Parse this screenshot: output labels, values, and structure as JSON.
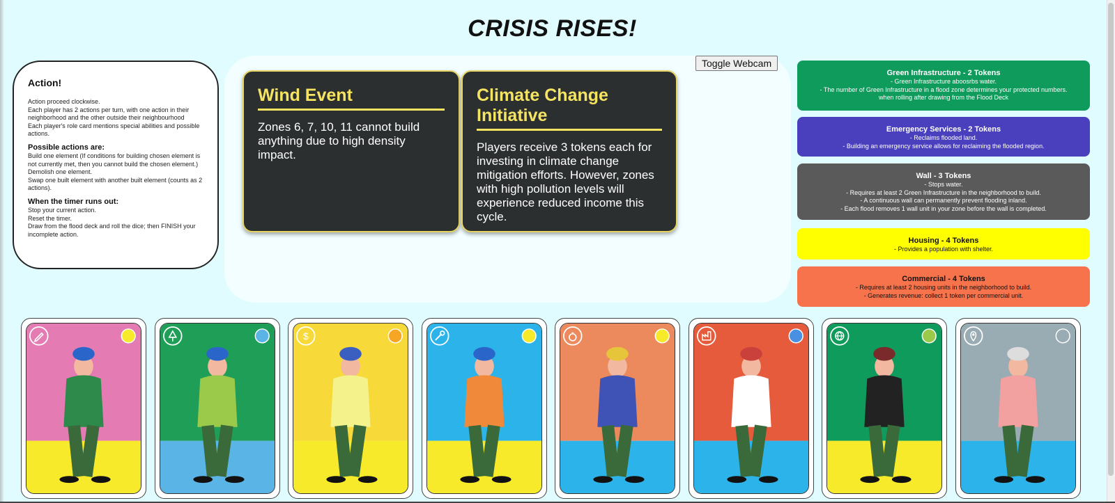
{
  "page": {
    "title": "CRISIS RISES!"
  },
  "action_panel": {
    "heading": "Action!",
    "intro": [
      "Action proceed clockwise.",
      "Each player has 2 actions per turn, with one action in their neighborhood and the other outside their neighbourhood",
      "Each player's role card mentions special abilities and possible actions."
    ],
    "possible_heading": "Possible actions are:",
    "possible": [
      "Build one element (If conditions for building chosen element is not currently met, then you cannot build the chosen element.)",
      "Demolish one element.",
      "Swap one built element with another built element (counts as 2 actions)."
    ],
    "timer_heading": "When the timer runs out:",
    "timer": [
      "Stop your current action.",
      "Reset the timer.",
      "Draw from the flood deck and roll the dice; then FINISH your incomplete action."
    ]
  },
  "webcam_button": "Toggle Webcam",
  "events": [
    {
      "title": "Wind Event",
      "text": "Zones 6, 7, 10, 11 cannot build anything due to high density impact."
    },
    {
      "title": "Climate Change Initiative",
      "text": "Players receive 3 tokens each for investing in climate change mitigation efforts. However, zones with high pollution levels will experience reduced income this cycle."
    }
  ],
  "buildings": [
    {
      "title": "Green Infrastructure - 2 Tokens",
      "lines": [
        "- Green Infrastructure aboosrbs water.",
        "- The number of Green Infrastructure in a flood zone determines your protected numbers.",
        "when rolling after drawing from the Flood Deck"
      ],
      "color": "#0f9b5b"
    },
    {
      "title": "Emergency Services - 2 Tokens",
      "lines": [
        "- Reclaims flooded land.",
        "- Building an emergency service allows for reclaiming the flooded region."
      ],
      "color": "#4a3fbd"
    },
    {
      "title": "Wall - 3 Tokens",
      "lines": [
        "- Stops water.",
        "- Requires at least 2 Green Infrastructure in the neighborhood to build.",
        "- A continuous wall can permanently prevent flooding inland.",
        "- Each flood removes 1 wall unit in your zone before the wall is completed."
      ],
      "color": "#5a5a5a"
    },
    {
      "title": "Housing - 4 Tokens",
      "lines": [
        "- Provides a population with shelter."
      ],
      "color": "#ffff00"
    },
    {
      "title": "Commercial - 4 Tokens",
      "lines": [
        "- Requires at least 2 housing units in the neighborhood to build.",
        "- Generates revenue: collect 1 token per commercial unit."
      ],
      "color": "#f6734c"
    }
  ],
  "roles": [
    {
      "icon": "pencil-icon",
      "top_color": "#e47bb3",
      "bottom_color": "#f7ea2a",
      "shirt": "#2e8a4a",
      "hair": "#2a66c9",
      "badge": "#f7ea2a"
    },
    {
      "icon": "tree-icon",
      "top_color": "#1f9e57",
      "bottom_color": "#5ab4e6",
      "shirt": "#9bc94a",
      "hair": "#2a66c9",
      "badge": "#5ab4e6"
    },
    {
      "icon": "dollar-icon",
      "top_color": "#f7d93a",
      "bottom_color": "#f7ea2a",
      "shirt": "#f4f28a",
      "hair": "#3a5fc0",
      "badge": "#f6a623"
    },
    {
      "icon": "wrench-icon",
      "top_color": "#2bb3ea",
      "bottom_color": "#f7ea2a",
      "shirt": "#f08a3a",
      "hair": "#2a66c9",
      "badge": "#f7ea2a"
    },
    {
      "icon": "money-bag-icon",
      "top_color": "#ec8a5d",
      "bottom_color": "#2bb3ea",
      "shirt": "#3f52b5",
      "hair": "#e6c53a",
      "badge": "#f7ea2a"
    },
    {
      "icon": "factory-icon",
      "top_color": "#e65b3c",
      "bottom_color": "#2bb3ea",
      "shirt": "#ffffff",
      "hair": "#c9413a",
      "badge": "#4a90e2"
    },
    {
      "icon": "globe-icon",
      "top_color": "#0f9b5b",
      "bottom_color": "#f7ea2a",
      "shirt": "#222222",
      "hair": "#7a2a2a",
      "badge": "#9bc94a"
    },
    {
      "icon": "location-icon",
      "top_color": "#9aacb3",
      "bottom_color": "#2bb3ea",
      "shirt": "#f3a0a0",
      "hair": "#dddddd",
      "badge": "#9aacb3"
    }
  ]
}
